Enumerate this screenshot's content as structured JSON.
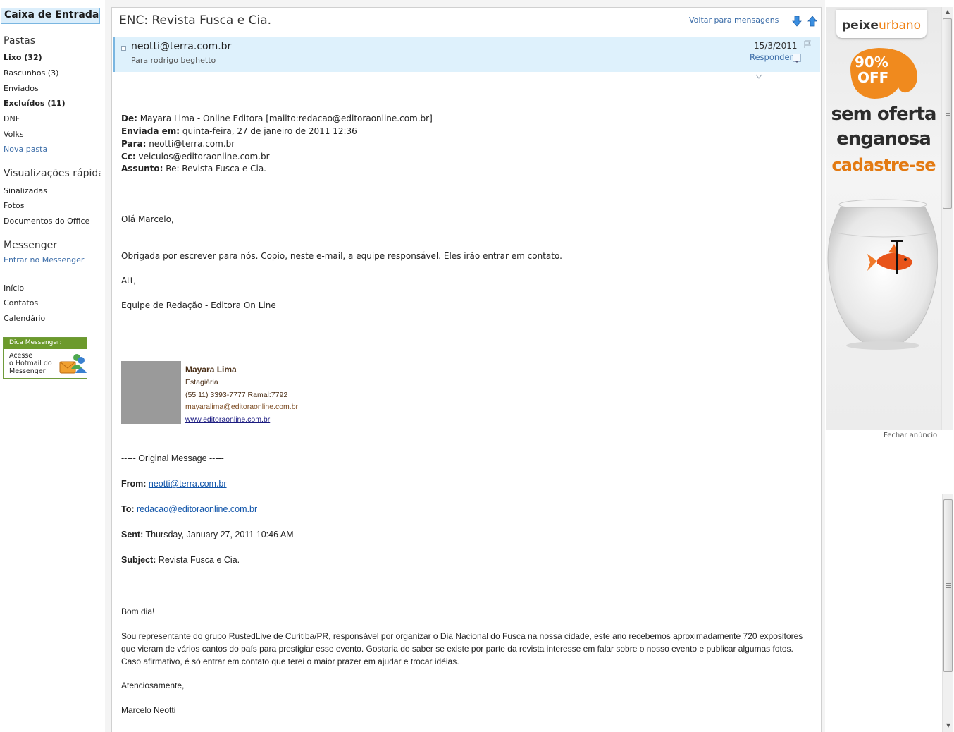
{
  "sidebar": {
    "inbox": "Caixa de Entrada",
    "folders_title": "Pastas",
    "folders": [
      {
        "label": "Lixo (32)",
        "bold": true
      },
      {
        "label": "Rascunhos (3)",
        "bold": false
      },
      {
        "label": "Enviados",
        "bold": false
      },
      {
        "label": "Excluídos (11)",
        "bold": true
      },
      {
        "label": "DNF",
        "bold": false
      },
      {
        "label": "Volks",
        "bold": false
      }
    ],
    "new_folder": "Nova pasta",
    "quick_views_title": "Visualizações rápidas",
    "quick_views": [
      "Sinalizadas",
      "Fotos",
      "Documentos do Office"
    ],
    "messenger_title": "Messenger",
    "messenger_link": "Entrar no Messenger",
    "nav": [
      "Início",
      "Contatos",
      "Calendário"
    ],
    "tip": {
      "title": "Dica Messenger:",
      "lines": [
        "Acesse",
        "o Hotmail do",
        "Messenger"
      ]
    }
  },
  "message": {
    "subject": "ENC: Revista Fusca e Cia.",
    "back_link": "Voltar para mensagens",
    "from": "neotti@terra.com.br",
    "to_line": "Para rodrigo beghetto",
    "date": "15/3/2011",
    "reply": "Responder",
    "fwd_header": {
      "de_label": "De:",
      "de_value": "Mayara Lima - Online Editora [mailto:redacao@editoraonline.com.br]",
      "enviada_label": "Enviada em:",
      "enviada_value": "quinta-feira, 27 de janeiro de 2011 12:36",
      "para_label": "Para:",
      "para_value": "neotti@terra.com.br",
      "cc_label": "Cc:",
      "cc_value": "veiculos@editoraonline.com.br",
      "assunto_label": "Assunto:",
      "assunto_value": "Re: Revista Fusca e Cia."
    },
    "greeting": "Olá Marcelo,",
    "reply_text": "Obrigada por escrever para nós. Copio, neste e-mail, a equipe responsável. Eles irão entrar em contato.",
    "att": "Att,",
    "team": "Equipe de Redação - Editora On Line",
    "signature": {
      "name": "Mayara Lima",
      "role": "Estagiária",
      "phone": "(55 11) 3393-7777 Ramal:7792",
      "email": "mayaralima@editoraonline.com.br",
      "site": "www.editoraonline.com.br"
    },
    "original": {
      "separator": "----- Original Message -----",
      "from_label": "From:",
      "from_value": "neotti@terra.com.br",
      "to_label": "To:",
      "to_value": "redacao@editoraonline.com.br",
      "sent_label": "Sent:",
      "sent_value": "Thursday, January 27, 2011 10:46 AM",
      "subject_label": "Subject:",
      "subject_value": "Revista Fusca e Cia.",
      "greeting": "Bom dia!",
      "body": "Sou representante do grupo RustedLive de Curitiba/PR, responsável por organizar o Dia Nacional do Fusca na nossa cidade, este ano recebemos aproximadamente 720 expositores que vieram de vários cantos do país para prestigiar esse evento. Gostaria de saber se existe por parte da revista interesse em falar sobre o nosso evento e publicar algumas fotos. Caso afirmativo, é só entrar em contato que terei o maior prazer em ajudar e trocar idéias.",
      "closing": "Atenciosamente,",
      "sender": "Marcelo Neotti"
    }
  },
  "ad": {
    "brand_a": "peixe",
    "brand_b": "urbano",
    "badge_1": "90%",
    "badge_2": "OFF",
    "line1": "sem oferta",
    "line2": "enganosa",
    "line3": "cadastre-se",
    "close": "Fechar anúncio"
  },
  "colors": {
    "accent_blue": "#3c6da8",
    "header_blue": "#def1fc",
    "ad_orange": "#ef8012"
  }
}
